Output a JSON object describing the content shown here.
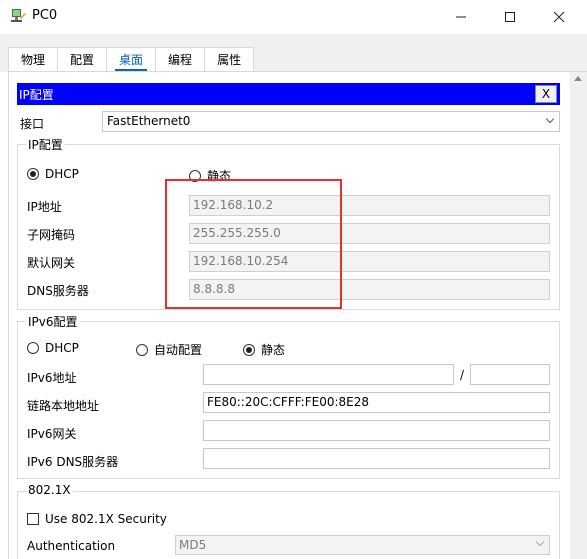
{
  "window": {
    "title": "PC0"
  },
  "tabs": [
    {
      "label": "物理"
    },
    {
      "label": "配置"
    },
    {
      "label": "桌面"
    },
    {
      "label": "编程"
    },
    {
      "label": "属性"
    }
  ],
  "ip_config": {
    "header": "IP配置",
    "close_label": "X",
    "interface_label": "接口",
    "interface_value": "FastEthernet0",
    "ipv4_group": "IP配置",
    "dhcp_label": "DHCP",
    "static_label": "静态",
    "ipv4_mode": "DHCP",
    "ip_label": "IP地址",
    "ip_value": "192.168.10.2",
    "mask_label": "子网掩码",
    "mask_value": "255.255.255.0",
    "gateway_label": "默认网关",
    "gateway_value": "192.168.10.254",
    "dns_label": "DNS服务器",
    "dns_value": "8.8.8.8"
  },
  "ipv6_config": {
    "group": "IPv6配置",
    "dhcp_label": "DHCP",
    "auto_label": "自动配置",
    "static_label": "静态",
    "mode": "静态",
    "addr_label": "IPv6地址",
    "addr_value": "",
    "slash": "/",
    "prefix_value": "",
    "linklocal_label": "链路本地地址",
    "linklocal_value": "FE80::20C:CFFF:FE00:8E28",
    "gateway_label": "IPv6网关",
    "gateway_value": "",
    "dns_label": "IPv6 DNS服务器",
    "dns_value": ""
  },
  "dot1x": {
    "group": "802.1X",
    "use_label": "Use 802.1X Security",
    "use_checked": false,
    "auth_label": "Authentication",
    "auth_value": "MD5"
  }
}
